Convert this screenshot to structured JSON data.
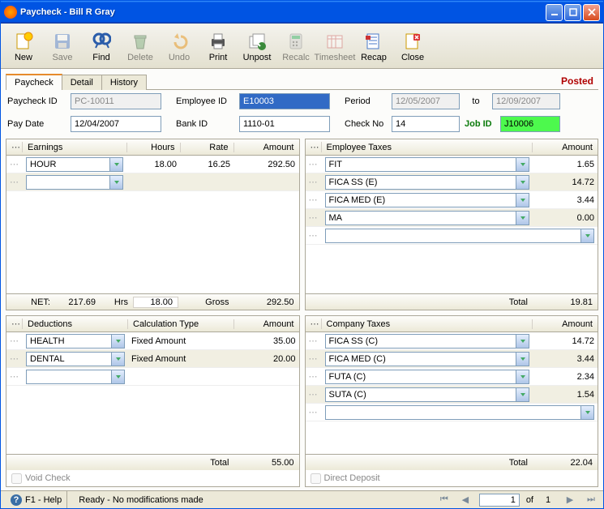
{
  "window": {
    "title": "Paycheck - Bill R Gray"
  },
  "toolbar": [
    {
      "label": "New",
      "icon": "new",
      "enabled": true
    },
    {
      "label": "Save",
      "icon": "save",
      "enabled": false
    },
    {
      "label": "Find",
      "icon": "find",
      "enabled": true
    },
    {
      "label": "Delete",
      "icon": "delete",
      "enabled": false
    },
    {
      "label": "Undo",
      "icon": "undo",
      "enabled": false
    },
    {
      "label": "Print",
      "icon": "print",
      "enabled": true
    },
    {
      "label": "Unpost",
      "icon": "unpost",
      "enabled": true
    },
    {
      "label": "Recalc",
      "icon": "recalc",
      "enabled": false
    },
    {
      "label": "Timesheet",
      "icon": "timesheet",
      "enabled": false
    },
    {
      "label": "Recap",
      "icon": "recap",
      "enabled": true
    },
    {
      "label": "Close",
      "icon": "close",
      "enabled": true
    }
  ],
  "tabs": {
    "items": [
      "Paycheck",
      "Detail",
      "History"
    ],
    "active": 0,
    "posted": "Posted"
  },
  "form": {
    "paycheck_id_label": "Paycheck ID",
    "paycheck_id": "PC-10011",
    "employee_id_label": "Employee ID",
    "employee_id": "E10003",
    "period_label": "Period",
    "period_from": "12/05/2007",
    "to_label": "to",
    "period_to": "12/09/2007",
    "pay_date_label": "Pay Date",
    "pay_date": "12/04/2007",
    "bank_id_label": "Bank ID",
    "bank_id": "1110-01",
    "check_no_label": "Check No",
    "check_no": "14",
    "job_id_label": "Job ID",
    "job_id": "J10006"
  },
  "earnings": {
    "title": "Earnings",
    "cols": [
      "Hours",
      "Rate",
      "Amount"
    ],
    "rows": [
      {
        "name": "HOUR",
        "hours": "18.00",
        "rate": "16.25",
        "amount": "292.50"
      }
    ],
    "footer": {
      "net_label": "NET:",
      "net": "217.69",
      "hrs_label": "Hrs",
      "hrs": "18.00",
      "gross_label": "Gross",
      "gross": "292.50"
    }
  },
  "emp_taxes": {
    "title": "Employee Taxes",
    "cols": [
      "Amount"
    ],
    "rows": [
      {
        "name": "FIT",
        "amount": "1.65"
      },
      {
        "name": "FICA SS (E)",
        "amount": "14.72"
      },
      {
        "name": "FICA MED (E)",
        "amount": "3.44"
      },
      {
        "name": "MA",
        "amount": "0.00"
      }
    ],
    "footer": {
      "total_label": "Total",
      "total": "19.81"
    }
  },
  "deductions": {
    "title": "Deductions",
    "cols": [
      "Calculation Type",
      "Amount"
    ],
    "rows": [
      {
        "name": "HEALTH",
        "calc": "Fixed Amount",
        "amount": "35.00"
      },
      {
        "name": "DENTAL",
        "calc": "Fixed Amount",
        "amount": "20.00"
      }
    ],
    "footer": {
      "total_label": "Total",
      "total": "55.00"
    },
    "void_label": "Void Check"
  },
  "comp_taxes": {
    "title": "Company Taxes",
    "cols": [
      "Amount"
    ],
    "rows": [
      {
        "name": "FICA SS (C)",
        "amount": "14.72"
      },
      {
        "name": "FICA MED (C)",
        "amount": "3.44"
      },
      {
        "name": "FUTA (C)",
        "amount": "2.34"
      },
      {
        "name": "SUTA (C)",
        "amount": "1.54"
      }
    ],
    "footer": {
      "total_label": "Total",
      "total": "22.04"
    },
    "dd_label": "Direct Deposit"
  },
  "status": {
    "help": "F1 - Help",
    "msg": "Ready - No modifications made",
    "page": "1",
    "of_label": "of",
    "total": "1"
  }
}
